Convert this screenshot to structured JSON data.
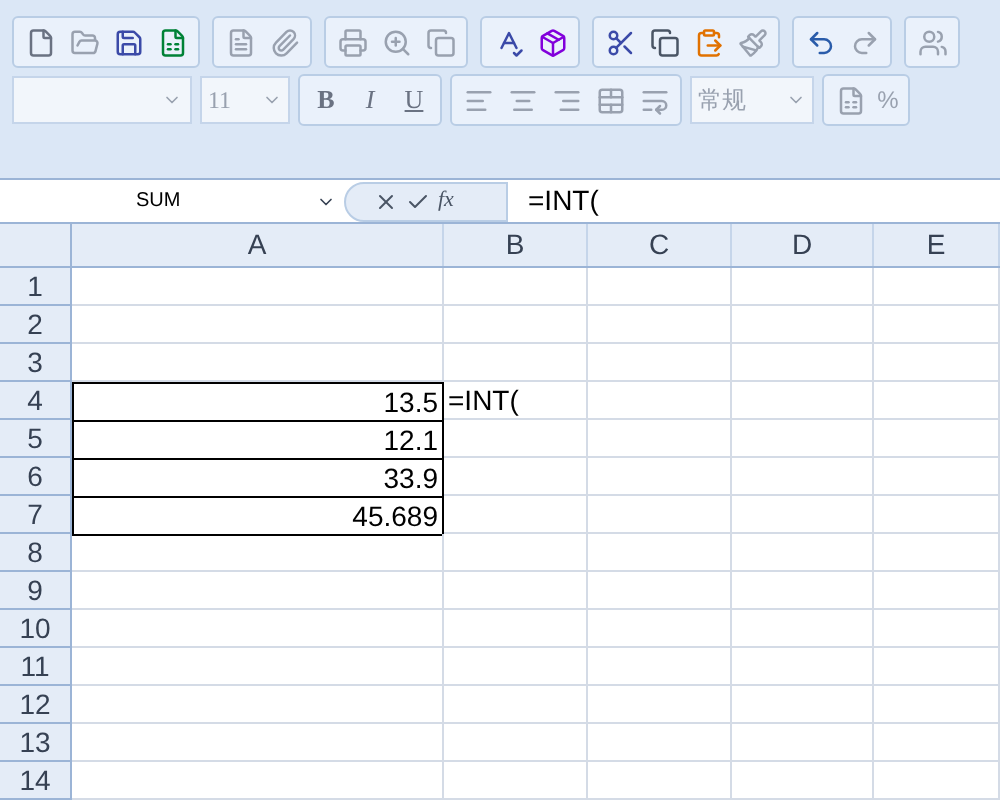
{
  "toolbar": {
    "font_size": "11",
    "format_buttons": [
      "B",
      "I",
      "U"
    ],
    "number_format": "常规",
    "percent": "%"
  },
  "formula_bar": {
    "name_box": "SUM",
    "function_button": "fx",
    "formula": "=INT("
  },
  "columns": [
    "A",
    "B",
    "C",
    "D",
    "E"
  ],
  "rows": [
    {
      "label": "1",
      "cells": [
        {},
        {},
        {},
        {},
        {}
      ]
    },
    {
      "label": "2",
      "cells": [
        {},
        {},
        {},
        {},
        {}
      ]
    },
    {
      "label": "3",
      "cells": [
        {},
        {},
        {},
        {},
        {}
      ]
    },
    {
      "label": "4",
      "cells": [
        {
          "value": "13.5",
          "bordered": true
        },
        {
          "value": "=INT("
        },
        {},
        {},
        {}
      ]
    },
    {
      "label": "5",
      "cells": [
        {
          "value": "12.1",
          "bordered": true
        },
        {},
        {},
        {},
        {}
      ]
    },
    {
      "label": "6",
      "cells": [
        {
          "value": "33.9",
          "bordered": true
        },
        {},
        {},
        {},
        {}
      ]
    },
    {
      "label": "7",
      "cells": [
        {
          "value": "45.689",
          "bordered": true
        },
        {},
        {},
        {},
        {}
      ]
    },
    {
      "label": "8",
      "cells": [
        {},
        {},
        {},
        {},
        {}
      ]
    },
    {
      "label": "9",
      "cells": [
        {},
        {},
        {},
        {},
        {}
      ]
    },
    {
      "label": "10",
      "cells": [
        {},
        {},
        {},
        {},
        {}
      ]
    },
    {
      "label": "11",
      "cells": [
        {},
        {},
        {},
        {},
        {}
      ]
    },
    {
      "label": "12",
      "cells": [
        {},
        {},
        {},
        {},
        {}
      ]
    },
    {
      "label": "13",
      "cells": [
        {},
        {},
        {},
        {},
        {}
      ]
    },
    {
      "label": "14",
      "cells": [
        {},
        {},
        {},
        {},
        {}
      ]
    }
  ]
}
